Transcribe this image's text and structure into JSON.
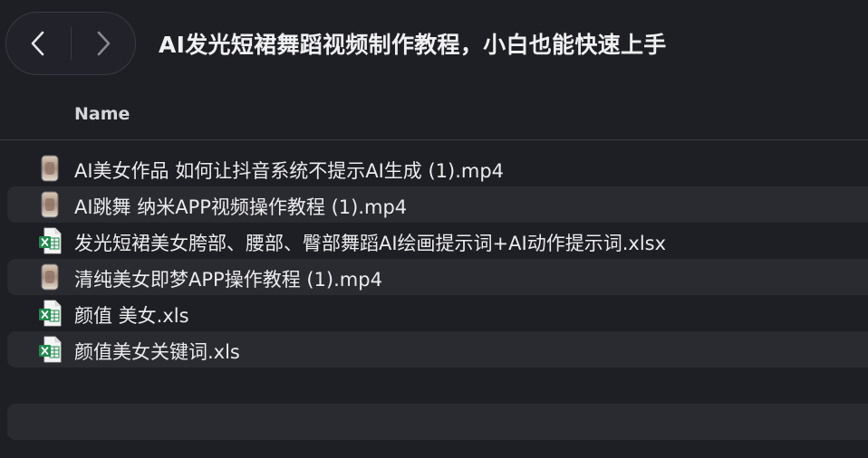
{
  "window": {
    "title": "AI发光短裙舞蹈视频制作教程，小白也能快速上手"
  },
  "nav": {
    "back_icon": "chevron-left-icon",
    "forward_icon": "chevron-right-icon"
  },
  "columns": {
    "name": "Name"
  },
  "files": [
    {
      "name": "AI美女作品  如何让抖音系统不提示AI生成 (1).mp4",
      "icon": "video-thumbnail-icon",
      "type": "video"
    },
    {
      "name": "AI跳舞 纳米APP视频操作教程 (1).mp4",
      "icon": "video-thumbnail-icon",
      "type": "video"
    },
    {
      "name": "发光短裙美女胯部、腰部、臀部舞蹈AI绘画提示词+AI动作提示词.xlsx",
      "icon": "excel-file-icon",
      "type": "spreadsheet"
    },
    {
      "name": "清纯美女即梦APP操作教程 (1).mp4",
      "icon": "video-thumbnail-icon",
      "type": "video"
    },
    {
      "name": "颜值 美女.xls",
      "icon": "excel-file-icon",
      "type": "spreadsheet"
    },
    {
      "name": "颜值美女关键词.xls",
      "icon": "excel-file-icon",
      "type": "spreadsheet"
    }
  ],
  "colors": {
    "background": "#1e1f24",
    "row_alt": "#2a2b30",
    "excel_green": "#1f8a4c"
  }
}
